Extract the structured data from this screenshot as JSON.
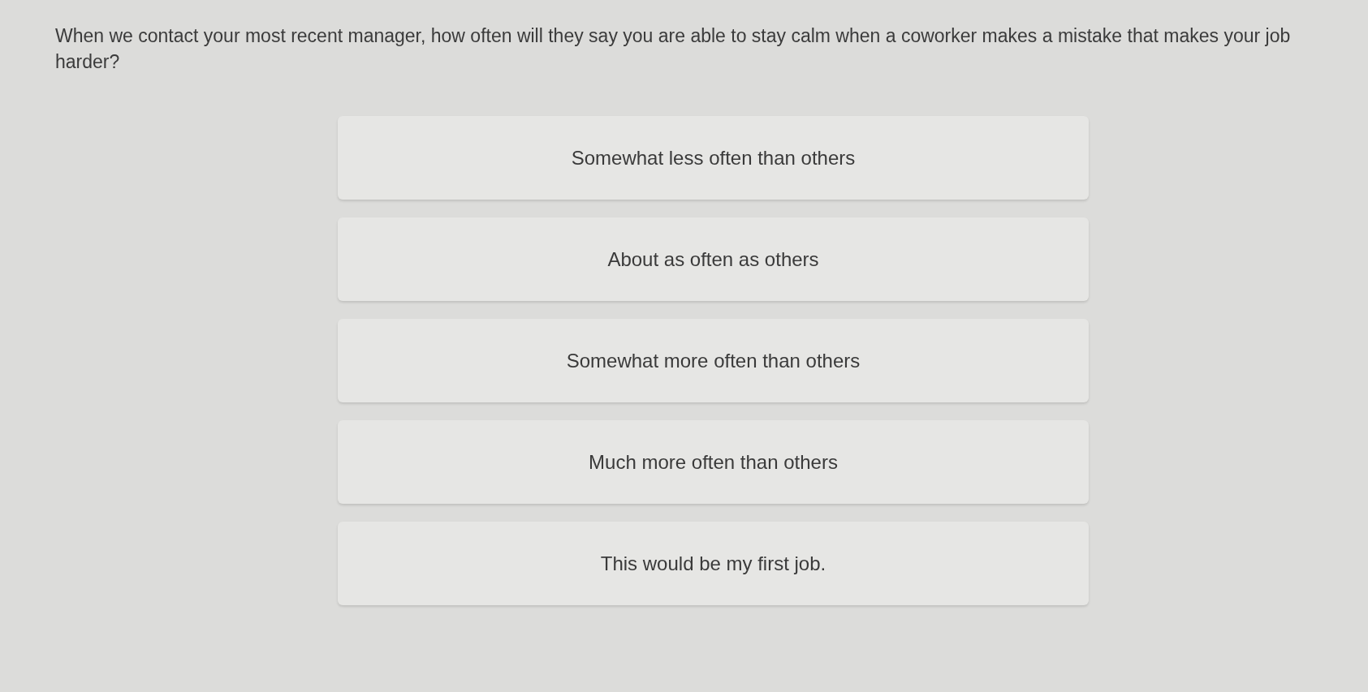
{
  "question": "When we contact your most recent manager, how often will they say you are able to stay calm when a coworker makes a mistake that makes your job harder?",
  "options": [
    {
      "label": "Somewhat less often than others"
    },
    {
      "label": "About as often as others"
    },
    {
      "label": "Somewhat more often than others"
    },
    {
      "label": "Much more often than others"
    },
    {
      "label": "This would be my first job."
    }
  ]
}
